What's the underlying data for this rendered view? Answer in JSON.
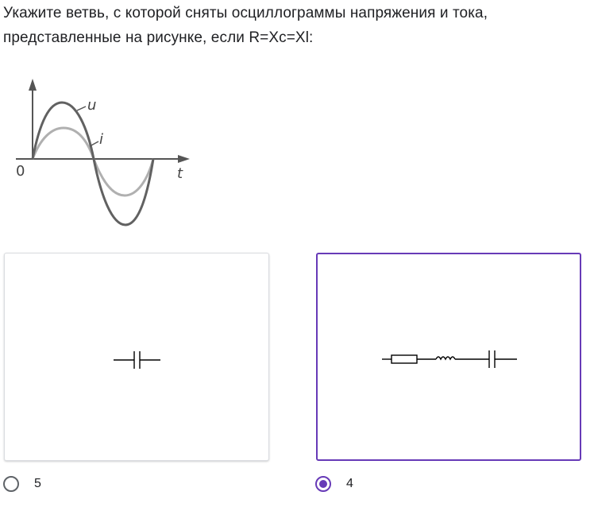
{
  "question": {
    "line1": "Укажите ветвь, с которой сняты осциллограммы напряжения и тока,",
    "line2": "представленные на рисунке, если R=Xc=Xl:"
  },
  "oscillogram": {
    "origin_label": "0",
    "time_label": "t",
    "voltage_label": "u",
    "current_label": "i"
  },
  "options": [
    {
      "label": "5",
      "circuit": "capacitor",
      "selected": false
    },
    {
      "label": "4",
      "circuit": "resistor-inductor-capacitor",
      "selected": true
    }
  ],
  "colors": {
    "accent": "#673ab7",
    "card_border": "#dadce0",
    "voltage_curve": "#616161",
    "current_curve": "#b0b0b0"
  }
}
